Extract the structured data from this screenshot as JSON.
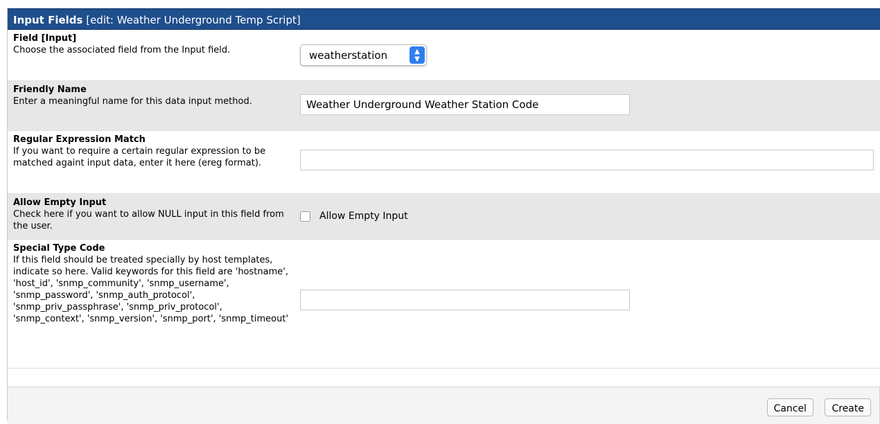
{
  "header": {
    "title": "Input Fields",
    "subtitle": "[edit: Weather Underground Temp Script]"
  },
  "fields": [
    {
      "label": "Field [Input]",
      "help": "Choose the associated field from the Input field.",
      "control": "select",
      "selected_value": "weatherstation"
    },
    {
      "label": "Friendly Name",
      "help": "Enter a meaningful name for this data input method.",
      "control": "text",
      "value": "Weather Underground Weather Station Code"
    },
    {
      "label": "Regular Expression Match",
      "help": "If you want to require a certain regular expression to be matched againt input data, enter it here (ereg format).",
      "control": "text",
      "value": ""
    },
    {
      "label": "Allow Empty Input",
      "help": "Check here if you want to allow NULL input in this field from the user.",
      "control": "checkbox",
      "checkbox_label": "Allow Empty Input",
      "checked": false
    },
    {
      "label": "Special Type Code",
      "help": "If this field should be treated specially by host templates, indicate so here. Valid keywords for this field are 'hostname', 'host_id', 'snmp_community', 'snmp_username', 'snmp_password', 'snmp_auth_protocol', 'snmp_priv_passphrase', 'snmp_priv_protocol', 'snmp_context', 'snmp_version', 'snmp_port', 'snmp_timeout'",
      "control": "text",
      "value": ""
    }
  ],
  "footer": {
    "cancel_label": "Cancel",
    "create_label": "Create"
  },
  "colors": {
    "header_bg": "#1f4e8c",
    "row_alt_bg": "#e7e7e7",
    "select_accent": "#2f7ef0"
  }
}
